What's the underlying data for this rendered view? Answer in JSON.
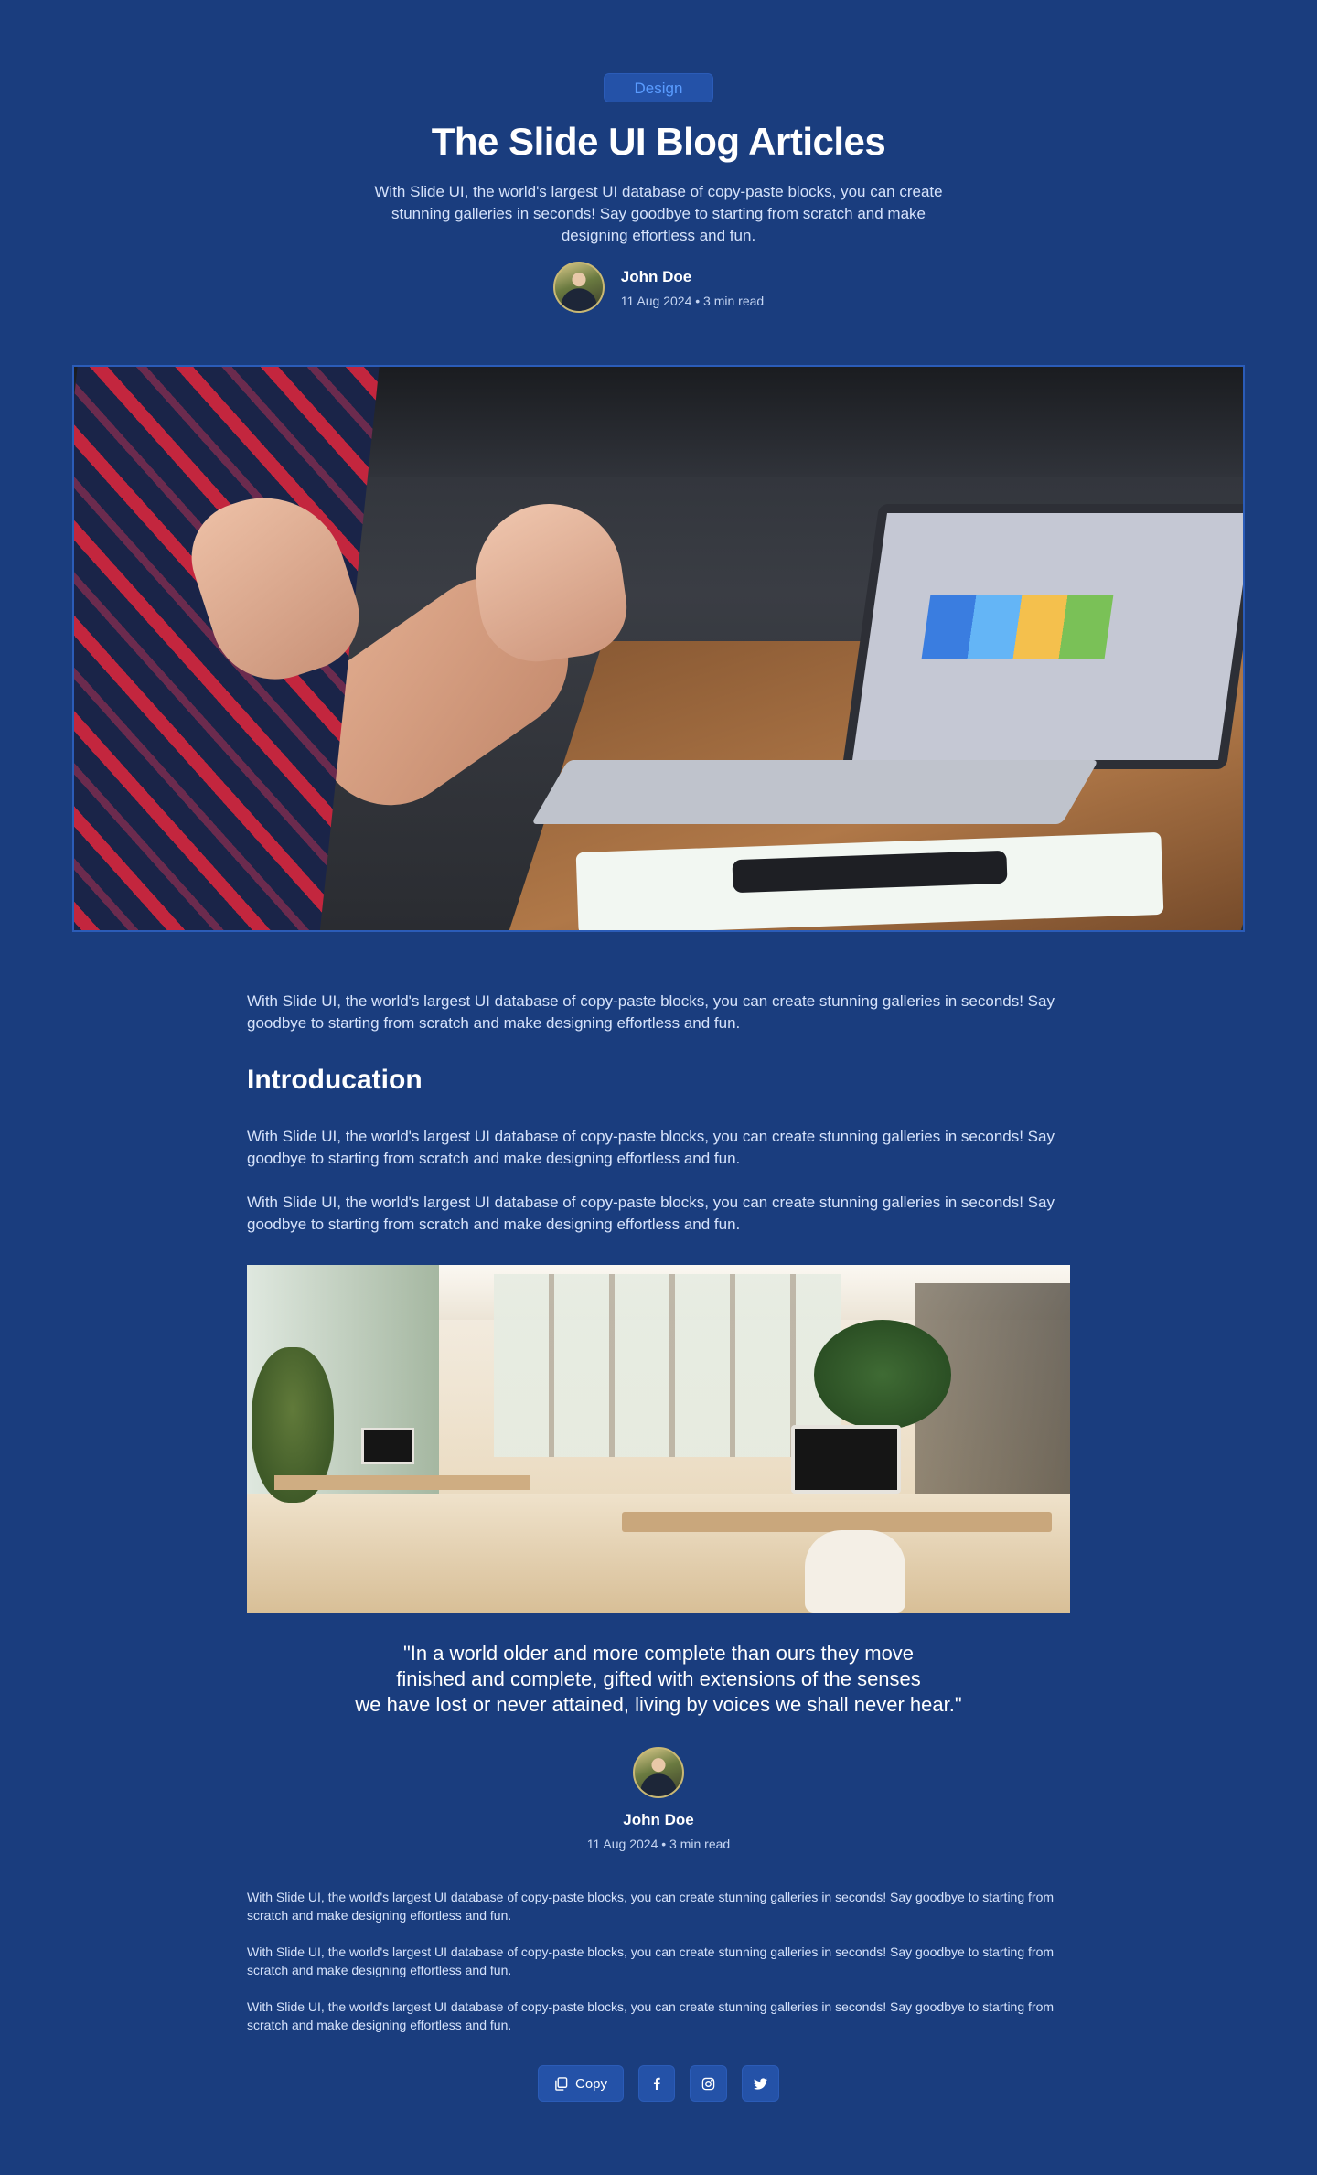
{
  "header": {
    "tag": "Design",
    "title": "The Slide UI Blog Articles",
    "subtitle": "With Slide UI, the world's largest UI database of copy-paste blocks, you can create stunning galleries in seconds! Say goodbye to starting from scratch and make designing effortless and fun.",
    "author": {
      "name": "John Doe",
      "meta": "11 Aug 2024 • 3 min read"
    }
  },
  "article": {
    "intro_paragraph": "With Slide UI, the world's largest UI database of copy-paste blocks, you can create stunning galleries in seconds! Say goodbye to starting from scratch and make designing effortless and fun.",
    "section_heading": "Introducation",
    "paragraph_1": "With Slide UI, the world's largest UI database of copy-paste blocks, you can create stunning galleries in seconds! Say goodbye to starting from scratch and make designing effortless and fun.",
    "paragraph_2": "With Slide UI, the world's largest UI database of copy-paste blocks, you can create stunning galleries in seconds! Say goodbye to starting from scratch and make designing effortless and fun.",
    "quote": "\"In a world older and more complete than ours they move\nfinished and complete, gifted with extensions of the senses\nwe have lost or never attained, living by voices we shall never hear.\"",
    "quote_author": {
      "name": "John Doe",
      "meta": "11 Aug 2024 • 3 min read"
    },
    "closing_paragraphs": [
      "With Slide UI, the world's largest UI database of copy-paste blocks, you can create stunning galleries in seconds! Say goodbye to starting from scratch and make designing effortless and fun.",
      "With Slide UI, the world's largest UI database of copy-paste blocks, you can create stunning galleries in seconds! Say goodbye to starting from scratch and make designing effortless and fun.",
      "With Slide UI, the world's largest UI database of copy-paste blocks, you can create stunning galleries in seconds! Say goodbye to starting from scratch and make designing effortless and fun."
    ]
  },
  "share": {
    "copy_label": "Copy",
    "icons": [
      "copy-icon",
      "facebook-icon",
      "instagram-icon",
      "twitter-icon"
    ]
  },
  "colors": {
    "background": "#1a3d7e",
    "tag_bg": "#2452a8",
    "tag_text": "#5a9cff",
    "body_text": "#d5e2fb"
  }
}
